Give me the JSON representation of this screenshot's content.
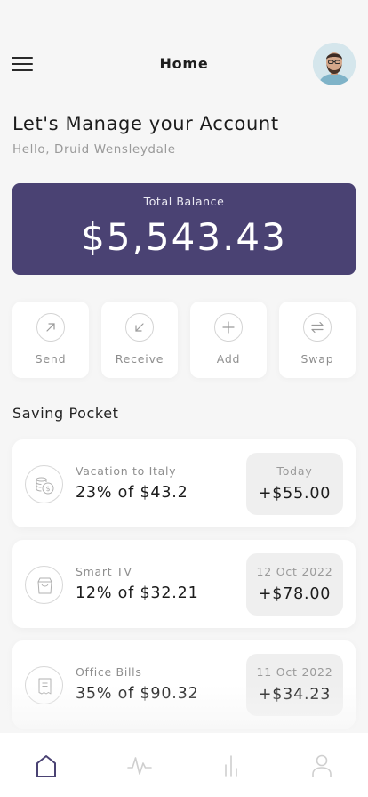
{
  "header": {
    "title": "Home",
    "menu_icon": "hamburger-menu-icon",
    "avatar_icon": "user-avatar"
  },
  "intro": {
    "heading": "Let's Manage your Account",
    "greeting": "Hello, Druid Wensleydale"
  },
  "balance": {
    "label": "Total Balance",
    "value": "$5,543.43",
    "card_color": "#4a4273"
  },
  "actions": [
    {
      "label": "Send",
      "icon": "arrow-up-right-icon"
    },
    {
      "label": "Receive",
      "icon": "arrow-down-left-icon"
    },
    {
      "label": "Add",
      "icon": "plus-icon"
    },
    {
      "label": "Swap",
      "icon": "swap-arrows-icon"
    }
  ],
  "saving_pocket": {
    "title": "Saving Pocket",
    "items": [
      {
        "name": "Vacation to Italy",
        "amount": "23% of $43.2",
        "date": "Today",
        "value": "+$55.00",
        "icon": "coins-icon"
      },
      {
        "name": "Smart TV",
        "amount": "12% of $32.21",
        "date": "12 Oct 2022",
        "value": "+$78.00",
        "icon": "shopping-bag-icon"
      },
      {
        "name": "Office Bills",
        "amount": "35% of $90.32",
        "date": "11 Oct 2022",
        "value": "+$34.23",
        "icon": "receipt-icon"
      }
    ]
  },
  "bottom_nav": [
    {
      "icon": "home-icon",
      "active": true
    },
    {
      "icon": "activity-icon",
      "active": false
    },
    {
      "icon": "bar-chart-icon",
      "active": false
    },
    {
      "icon": "profile-icon",
      "active": false
    }
  ],
  "colors": {
    "accent": "#4a4273",
    "background": "#f6f6f6",
    "muted_text": "#8e8e8e"
  }
}
